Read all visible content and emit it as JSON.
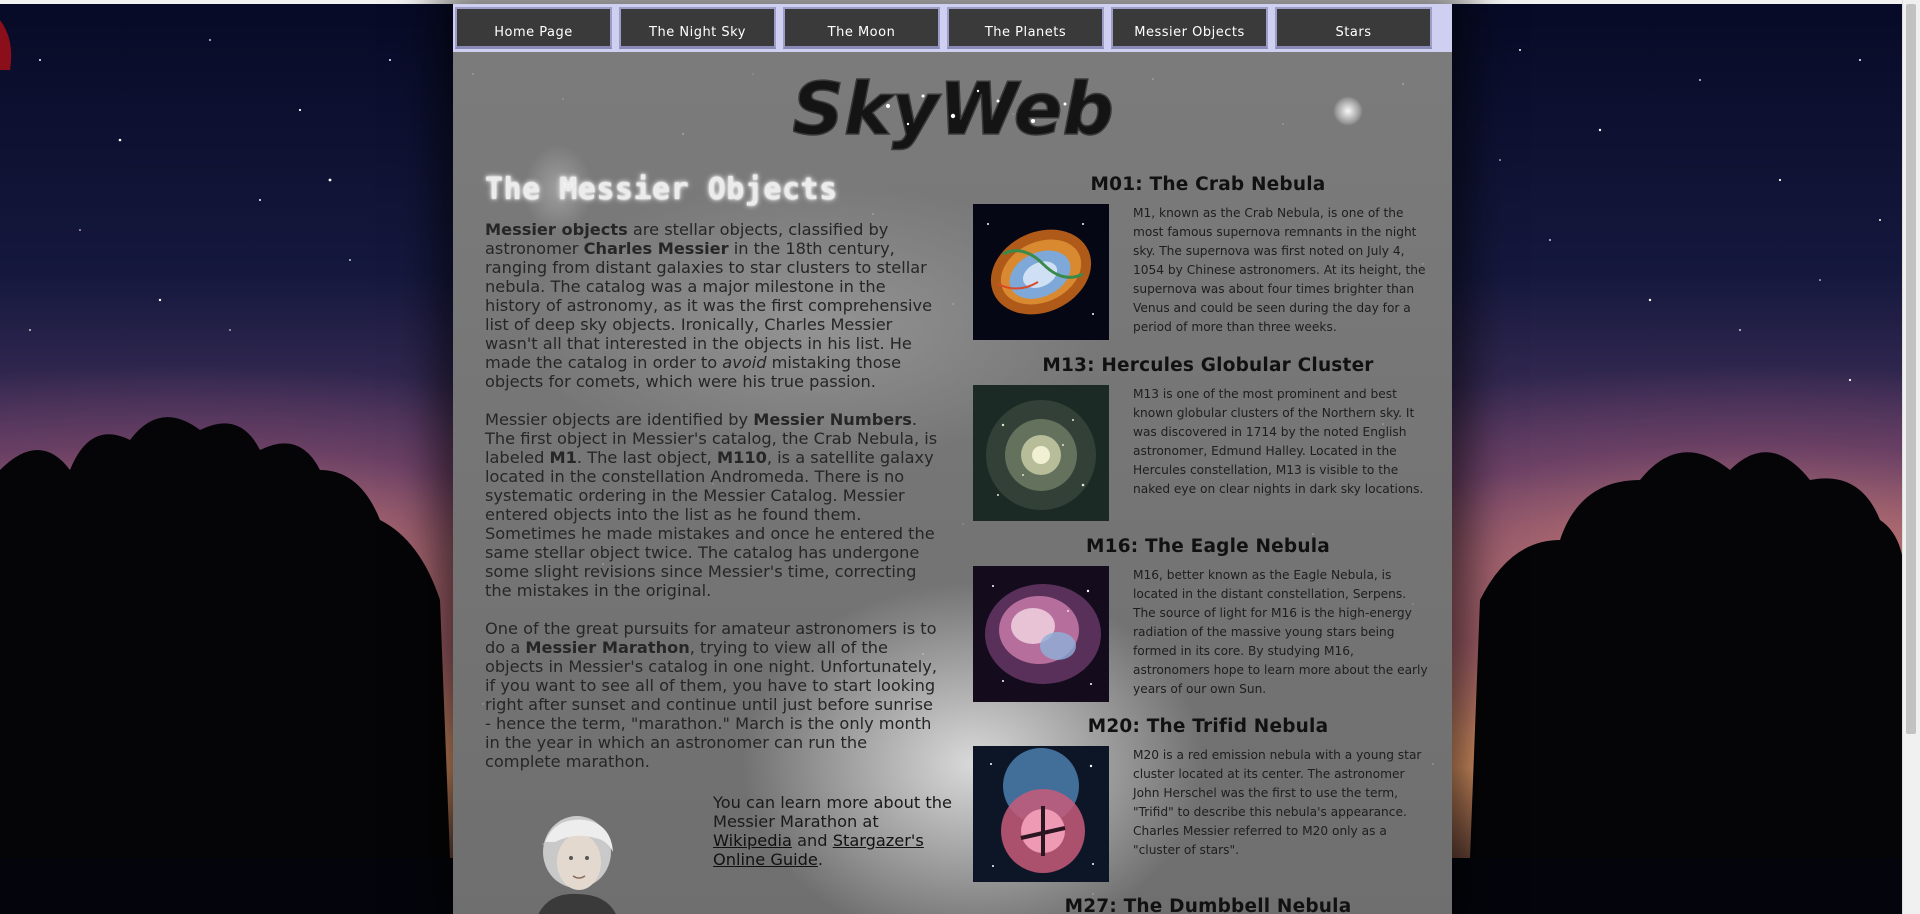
{
  "nav": {
    "tabs": [
      "Home Page",
      "The Night Sky",
      "The Moon",
      "The Planets",
      "Messier Objects",
      "Stars"
    ]
  },
  "logo": {
    "text": "SkyWeb"
  },
  "left": {
    "title": "The Messier Objects",
    "p1": {
      "b1": "Messier objects",
      "t1": " are stellar objects, classified by astronomer ",
      "b2": "Charles Messier",
      "t2": " in the 18th century, ranging from distant galaxies to star clusters to stellar nebula. The catalog was a major milestone in the history of astronomy, as it was the first comprehensive list of deep sky objects. Ironically, Charles Messier wasn't all that interested in the objects in his list. He made the catalog in order to ",
      "i1": "avoid",
      "t3": " mistaking those objects for comets, which were his true passion."
    },
    "p2": {
      "t1": "Messier objects are identified by ",
      "b1": "Messier Numbers",
      "t2": ". The first object in Messier's catalog, the Crab Nebula, is labeled ",
      "b2": "M1",
      "t3": ". The last object, ",
      "b3": "M110",
      "t4": ", is a satellite galaxy located in the constellation Andromeda. There is no systematic ordering in the Messier Catalog. Messier entered objects into the list as he found them. Sometimes he made mistakes and once he entered the same stellar object twice. The catalog has undergone some slight revisions since Messier's time, correcting the mistakes in the original."
    },
    "p3": {
      "t1": "One of the great pursuits for amateur astronomers is to do a ",
      "b1": "Messier Marathon",
      "t2": ", trying to view all of the objects in Messier's catalog in one night. Unfortunately, if you want to see all of them, you have to start looking right after sunset and continue until just before sunrise - hence the term, \"marathon.\" March is the only month in the year in which an astronomer can run the complete marathon."
    },
    "learn": {
      "t1": "You can learn more about the Messier Marathon at ",
      "link1": "Wikipedia",
      "t2": " and ",
      "link2": "Stargazer's Online Guide",
      "t3": "."
    }
  },
  "objects": [
    {
      "title": "M01: The Crab Nebula",
      "desc": "M1, known as the Crab Nebula, is one of the most famous supernova remnants in the night sky. The supernova was first noted on July 4, 1054 by Chinese astronomers. At its height, the supernova was about four times brighter than Venus and could be seen during the day for a period of more than three weeks."
    },
    {
      "title": "M13: Hercules Globular Cluster",
      "desc": "M13 is one of the most prominent and best known globular clusters of the Northern sky. It was discovered in 1714 by the noted English astronomer, Edmund Halley. Located in the Hercules constellation, M13 is visible to the naked eye on clear nights in dark sky locations."
    },
    {
      "title": "M16: The Eagle Nebula",
      "desc": "M16, better known as the Eagle Nebula, is located in the distant constellation, Serpens. The source of light for M16 is the high-energy radiation of the massive young stars being formed in its core. By studying M16, astronomers hope to learn more about the early years of our own Sun."
    },
    {
      "title": "M20: The Trifid Nebula",
      "desc": "M20 is a red emission nebula with a young star cluster located at its center. The astronomer John Herschel was the first to use the term, \"Trifid\" to describe this nebula's appearance. Charles Messier referred to M20 only as a \"cluster of stars\"."
    },
    {
      "title": "M27: The Dumbbell Nebula",
      "desc": ""
    }
  ]
}
